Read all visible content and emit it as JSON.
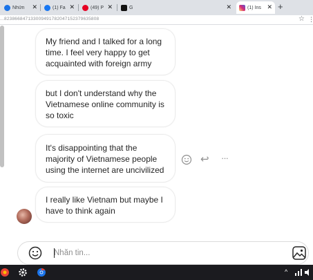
{
  "browser": {
    "tabs": [
      {
        "title": "Nhữn",
        "favicon_color": "#1a73e8"
      },
      {
        "title": "(1) Fa",
        "favicon_color": "#1877f2"
      },
      {
        "title": "(49) P",
        "favicon_color": "#e60023"
      },
      {
        "title": "G",
        "favicon_color": "#111111"
      },
      {
        "title": "(1) Ins",
        "favicon_color": "#dd2a7b"
      }
    ],
    "new_tab_glyph": "+",
    "close_glyph": "✕",
    "url": "...823866847133009491782047152379635808",
    "star_glyph": "☆",
    "menu_glyph": "⋮"
  },
  "messages": [
    {
      "text": "My friend and I talked for a long time. I feel very happy to get acquainted with foreign army"
    },
    {
      "text": "but I don't understand why the Vietnamese online community is so toxic"
    },
    {
      "text": "It's disappointing that the majority of Vietnamese people using the internet are uncivilized"
    },
    {
      "text": "I really like Vietnam but maybe I have to think again"
    }
  ],
  "hover_actions": {
    "react_icon": "smiley-icon",
    "reply_glyph": "↩",
    "more_glyph": "···"
  },
  "composer": {
    "placeholder": "Nhắn tin..."
  },
  "taskbar": {
    "tray_glyph": "^"
  }
}
